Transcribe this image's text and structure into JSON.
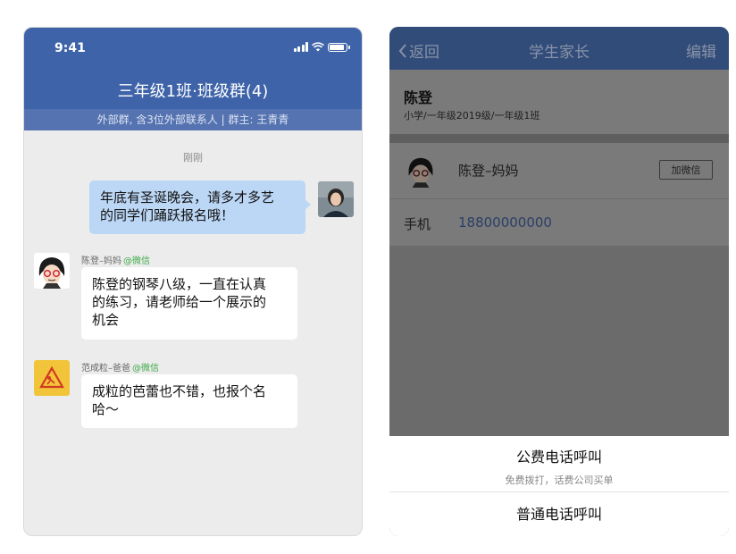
{
  "left": {
    "status": {
      "time": "9:41"
    },
    "group_title": "三年级1班·班级群(4)",
    "group_sub": "外部群, 含3位外部联系人 | 群主: 王青青",
    "time_sep": "刚刚",
    "messages": [
      {
        "text_l1": "年底有圣诞晚会，请多才多艺",
        "text_l2": "的同学们踊跃报名哦！"
      },
      {
        "sender": "陈登–妈妈",
        "tag": "@微信",
        "text_l1": "陈登的钢琴八级，一直在认真",
        "text_l2": "的练习，请老师给一个展示的",
        "text_l3": "机会"
      },
      {
        "sender": "范成粒–爸爸",
        "tag": "@微信",
        "text_l1": "成粒的芭蕾也不错，也报个名",
        "text_l2": "哈～"
      }
    ]
  },
  "right": {
    "nav": {
      "back": "返回",
      "title": "学生家长",
      "edit": "编辑"
    },
    "student": {
      "name": "陈登",
      "class": "小学/一年级2019级/一年级1班"
    },
    "parent": {
      "name": "陈登–妈妈",
      "add_wechat": "加微信"
    },
    "phone": {
      "label": "手机",
      "number": "18800000000"
    },
    "sheet": {
      "option1_title": "公费电话呼叫",
      "option1_sub": "免费拨打，话费公司买单",
      "option2": "普通电话呼叫"
    }
  },
  "colors": {
    "header_blue": "#3e63a8",
    "bubble_me": "#bcd7f5",
    "wechat_green": "#3eaa4a"
  }
}
